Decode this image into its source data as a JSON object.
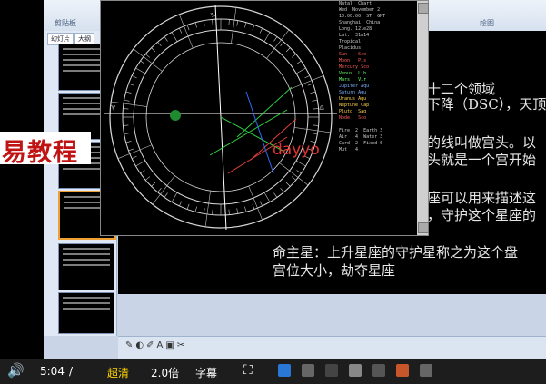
{
  "player": {
    "time": "5:04",
    "time_sep": "/",
    "quality": "超清",
    "speed": "2.0倍",
    "subtitles": "字幕"
  },
  "ribbon": {
    "group1": "剪贴板",
    "group2": "绘图"
  },
  "thumbnail_pane": {
    "tabs": [
      "幻灯片",
      "大纲"
    ]
  },
  "slide": {
    "lines": [
      "十二个领域",
      "下降（DSC），天顶",
      "的线叫做宫头。以",
      "头就是一个宫开始",
      "座可以用来描述这",
      "，守护这个星座的",
      "命主星：上升星座的守护星称之为这个盘",
      "宫位大小，劫夺星座"
    ]
  },
  "watermark": {
    "banner": "易教程",
    "site": "dayyo"
  },
  "colors": {
    "watermark_red": "#c01414",
    "slide_bg": "#000000",
    "chart_circle": "#d8d8d8",
    "aspect_green": "#2ecc40",
    "aspect_red": "#e0403a",
    "aspect_blue": "#2f6bff"
  },
  "icons": [
    "volume-icon",
    "fullscreen-icon",
    "windows-start-icon",
    "pen-icon"
  ]
}
